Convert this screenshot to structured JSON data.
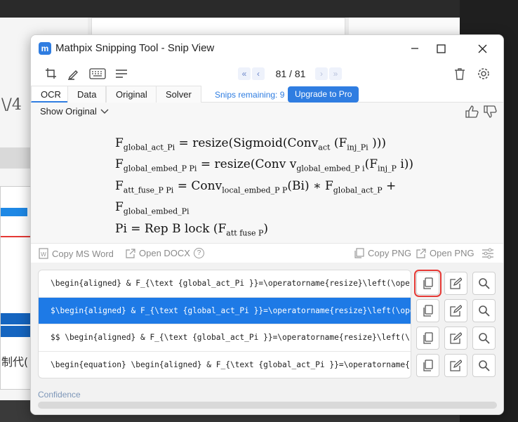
{
  "window": {
    "title": "Mathpix Snipping Tool - Snip View",
    "logo_glyph": "m"
  },
  "pager": {
    "count": "81 / 81"
  },
  "tabs": [
    {
      "label": "OCR",
      "active": true
    },
    {
      "label": "Data"
    },
    {
      "label": "Original"
    },
    {
      "label": "Solver"
    }
  ],
  "snips": "Snips remaining: 9",
  "upgrade_label": "Upgrade to Pro",
  "show_original": "Show Original",
  "math": {
    "l1": {
      "a": "F",
      "a_sub": "global_act_Pi",
      "b": " = resize(Sigmoid(Conv",
      "b_sub": "act",
      "c": " (F",
      "c_sub": "inj_Pi",
      "d": " )))"
    },
    "l2": {
      "a": "F",
      "a_sub": "global_embed_P Pi",
      "b": " = resize(Conv v",
      "b_sub": "global_embed_P i",
      "c": "(F",
      "c_sub": "inj_P",
      "d": " i))"
    },
    "l3": {
      "a": "F",
      "a_sub": "att_fuse_P Pi",
      "b": " = Conv",
      "b_sub": "local_embed_P P",
      "c": "(Bi) ∗ F",
      "c_sub": "global_act_P",
      "d": " +"
    },
    "l4": {
      "a": "F",
      "a_sub": "global_embed_Pi"
    },
    "l5": {
      "a": "Pi = Rep B lock (F",
      "a_sub": "att  fuse P",
      "b": ")"
    }
  },
  "actions": {
    "copy_ms_word": "Copy MS Word",
    "open_docx": "Open DOCX",
    "help": "?",
    "copy_png": "Copy PNG",
    "open_png": "Open PNG"
  },
  "results": [
    "\\begin{aligned} & F_{\\text {global_act_Pi }}=\\operatorname{resize}\\left(\\oper",
    "$\\begin{aligned} & F_{\\text {global_act_Pi }}=\\operatorname{resize}\\left(\\ope",
    "$$  \\begin{aligned} & F_{\\text {global_act_Pi }}=\\operatorname{resize}\\left(\\",
    "\\begin{equation}  \\begin{aligned} & F_{\\text {global_act_Pi }}=\\operatorname{"
  ],
  "confidence_label": "Confidence",
  "background": {
    "side_text": "\\/4",
    "side_text2": "制代("
  },
  "colors": {
    "accent": "#2f7de1",
    "selected_row": "#1e7ae6",
    "highlight": "#e53935"
  }
}
